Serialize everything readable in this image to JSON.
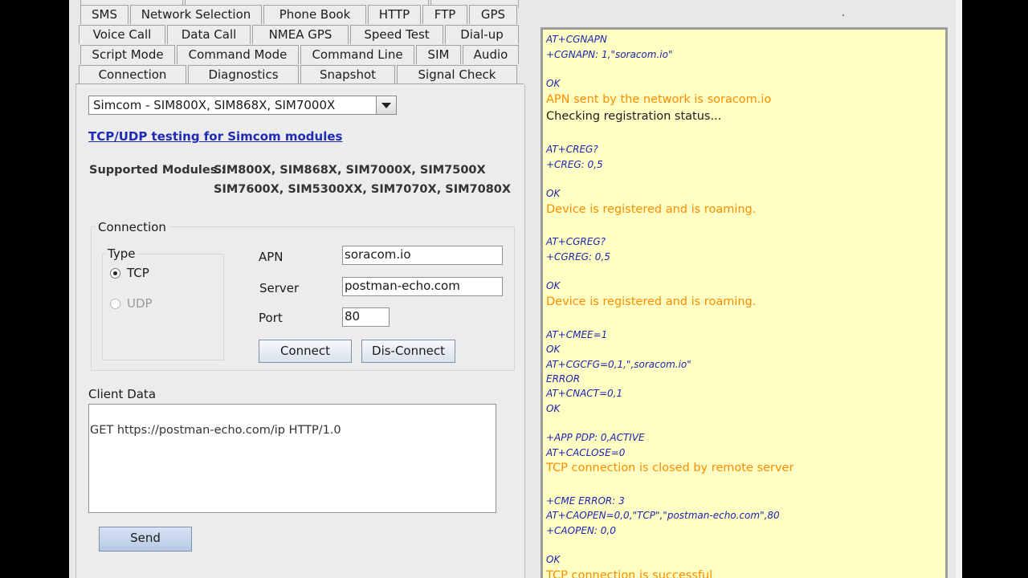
{
  "tabs": {
    "row0": [
      "",
      "",
      ""
    ],
    "row1": [
      "SMS",
      "Network Selection",
      "Phone Book",
      "HTTP",
      "FTP",
      "GPS"
    ],
    "row2": [
      "Voice Call",
      "Data Call",
      "NMEA GPS",
      "Speed Test",
      "Dial-up"
    ],
    "row3": [
      "Script Mode",
      "Command Mode",
      "Command Line",
      "SIM",
      "Audio"
    ],
    "row4": [
      "Connection",
      "Diagnostics",
      "Snapshot",
      "Signal Check"
    ]
  },
  "module_select": {
    "value": "Simcom - SIM800X, SIM868X, SIM7000X"
  },
  "tcp_link": "TCP/UDP testing for Simcom modules",
  "supported": {
    "label": "Supported Modules :",
    "line1": "SIM800X, SIM868X, SIM7000X, SIM7500X",
    "line2": "SIM7600X, SIM5300XX, SIM7070X, SIM7080X"
  },
  "connection": {
    "legend": "Connection",
    "type_legend": "Type",
    "tcp_label": "TCP",
    "udp_label": "UDP",
    "apn_label": "APN",
    "apn_value": "soracom.io",
    "server_label": "Server",
    "server_value": "postman-echo.com",
    "port_label": "Port",
    "port_value": "80",
    "connect_label": "Connect",
    "disconnect_label": "Dis-Connect"
  },
  "client": {
    "label": "Client Data",
    "text": "GET https://postman-echo.com/ip HTTP/1.0",
    "send_label": "Send"
  },
  "console": {
    "lines": [
      {
        "kind": "cmd",
        "text": "AT+CGNAPN"
      },
      {
        "kind": "cmd",
        "text": "+CGNAPN: 1,\"soracom.io\""
      },
      {
        "kind": "cmd",
        "text": "OK"
      },
      {
        "kind": "info",
        "text": "APN sent by the network is soracom.io"
      },
      {
        "kind": "status",
        "text": "Checking registration status..."
      },
      {
        "kind": "cmd",
        "text": "AT+CREG?"
      },
      {
        "kind": "cmd",
        "text": "+CREG: 0,5"
      },
      {
        "kind": "cmd",
        "text": "OK"
      },
      {
        "kind": "info",
        "text": "Device is registered and is roaming."
      },
      {
        "kind": "cmd",
        "text": "AT+CGREG?"
      },
      {
        "kind": "cmd",
        "text": "+CGREG: 0,5"
      },
      {
        "kind": "cmd",
        "text": "OK"
      },
      {
        "kind": "info",
        "text": "Device is registered and is roaming."
      },
      {
        "kind": "cmd",
        "text": "AT+CMEE=1"
      },
      {
        "kind": "cmd",
        "text": "OK"
      },
      {
        "kind": "cmd",
        "text": "AT+CGCFG=0,1,\",soracom.io\""
      },
      {
        "kind": "cmd",
        "text": "ERROR"
      },
      {
        "kind": "cmd",
        "text": "AT+CNACT=0,1"
      },
      {
        "kind": "cmd",
        "text": "OK"
      },
      {
        "kind": "cmd",
        "text": "+APP PDP: 0,ACTIVE"
      },
      {
        "kind": "cmd",
        "text": "AT+CACLOSE=0"
      },
      {
        "kind": "info",
        "text": "TCP connection is closed by remote server"
      },
      {
        "kind": "cmd",
        "text": "+CME ERROR: 3"
      },
      {
        "kind": "cmd",
        "text": "AT+CAOPEN=0,0,\"TCP\",\"postman-echo.com\",80"
      },
      {
        "kind": "cmd",
        "text": "+CAOPEN: 0,0"
      },
      {
        "kind": "cmd",
        "text": "OK"
      },
      {
        "kind": "info",
        "text": "TCP connection is successful"
      }
    ]
  }
}
